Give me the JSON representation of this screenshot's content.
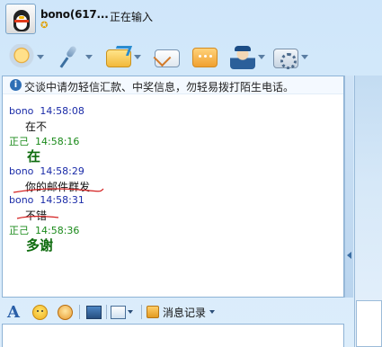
{
  "header": {
    "contact_name": "bono(617...",
    "status": "正在输入"
  },
  "notice": {
    "text": "交谈中请勿轻信汇款、中奖信息，勿轻易拨打陌生电话。"
  },
  "messages": [
    {
      "sender": "bono",
      "time": "14:58:08",
      "text": "在不"
    },
    {
      "sender": "正己",
      "time": "14:58:16",
      "text": "在"
    },
    {
      "sender": "bono",
      "time": "14:58:29",
      "text": "你的邮件群发"
    },
    {
      "sender": "bono",
      "time": "14:58:31",
      "text": "不错"
    },
    {
      "sender": "正己",
      "time": "14:58:36",
      "text": "多谢"
    }
  ],
  "input_toolbar": {
    "history_label": "消息记录"
  },
  "colors": {
    "accent": "#2a5fa8",
    "sender_other": "#1a2ba8",
    "sender_self": "#1a8a1a",
    "self_message": "#0d6b0d",
    "red_underline": "#d42020"
  },
  "icons": {
    "toolbar": [
      "video-camera-icon",
      "microphone-icon",
      "file-transfer-icon",
      "email-icon",
      "chat-bubble-icon",
      "agent-icon",
      "settings-icon"
    ],
    "input": [
      "font-icon",
      "emoticon-icon",
      "magic-face-icon",
      "image-icon",
      "screenshot-icon",
      "history-icon"
    ]
  }
}
